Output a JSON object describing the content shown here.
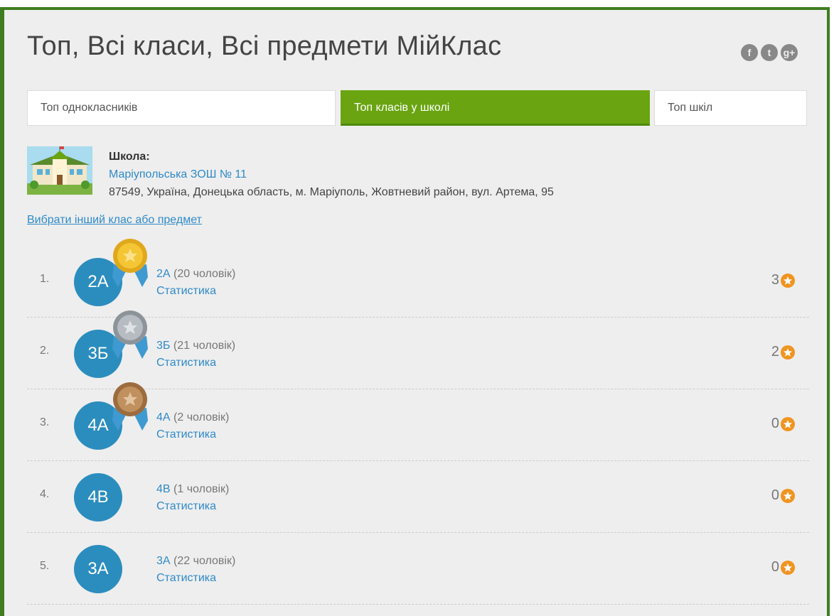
{
  "page": {
    "title": "Топ, Всі класи, Всі предмети МійКлас"
  },
  "social": [
    {
      "name": "facebook-icon",
      "glyph": "f"
    },
    {
      "name": "twitter-icon",
      "glyph": "t"
    },
    {
      "name": "google-plus-icon",
      "glyph": "g+"
    }
  ],
  "tabs": {
    "classmates": "Топ однокласників",
    "classes": "Топ класів у школі",
    "schools": "Топ шкіл"
  },
  "school": {
    "label": "Школа:",
    "name": "Маріупольська ЗОШ № 11",
    "address": "87549, Україна, Донецька область, м. Маріуполь, Жовтневий район, вул. Артема, 95"
  },
  "choose_link": "Вибрати інший клас або предмет",
  "ranking": [
    {
      "rank": "1.",
      "avatar": "2А",
      "class": "2А",
      "people": "(20 чоловік)",
      "stat": "Статистика",
      "score": "3",
      "medal": "gold"
    },
    {
      "rank": "2.",
      "avatar": "3Б",
      "class": "3Б",
      "people": "(21 чоловік)",
      "stat": "Статистика",
      "score": "2",
      "medal": "silver"
    },
    {
      "rank": "3.",
      "avatar": "4А",
      "class": "4А",
      "people": "(2 чоловік)",
      "stat": "Статистика",
      "score": "0",
      "medal": "bronze"
    },
    {
      "rank": "4.",
      "avatar": "4В",
      "class": "4В",
      "people": "(1 чоловік)",
      "stat": "Статистика",
      "score": "0",
      "medal": "none"
    },
    {
      "rank": "5.",
      "avatar": "3А",
      "class": "3А",
      "people": "(22 чоловік)",
      "stat": "Статистика",
      "score": "0",
      "medal": "none"
    }
  ],
  "colors": {
    "frame": "#3f7d20",
    "accent_tab": "#6aa411",
    "avatar": "#2b8dbe",
    "link": "#2f8ac8",
    "star": "#f09420",
    "gold": "#f2c230",
    "silver": "#a9b0b5",
    "bronze": "#b98556"
  }
}
